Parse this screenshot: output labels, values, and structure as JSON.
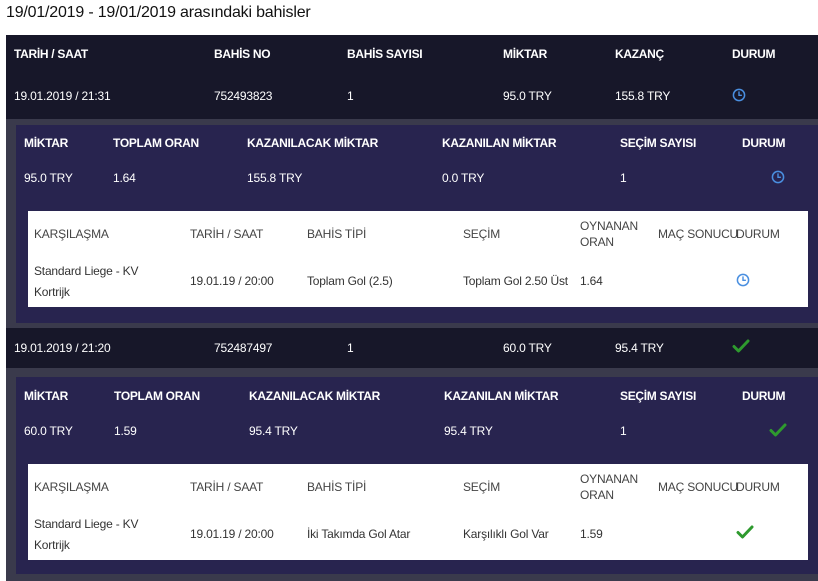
{
  "page_title": "19/01/2019 - 19/01/2019 arasındaki bahisler",
  "main_headers": [
    "TARİH / SAAT",
    "BAHİS NO",
    "BAHİS SAYISI",
    "MİKTAR",
    "KAZANÇ",
    "DURUM"
  ],
  "detail_headers": [
    "MİKTAR",
    "TOPLAM ORAN",
    "KAZANILACAK MİKTAR",
    "KAZANILAN MİKTAR",
    "SEÇİM SAYISI",
    "DURUM"
  ],
  "inner_headers": [
    "KARŞILAŞMA",
    "TARİH / SAAT",
    "BAHİS TİPİ",
    "SEÇİM",
    "OYNANAN ORAN",
    "MAÇ SONUCU",
    "DURUM"
  ],
  "bets": [
    {
      "date": "19.01.2019 / 21:31",
      "bet_no": "752493823",
      "count": "1",
      "amount": "95.0 TRY",
      "win": "155.8 TRY",
      "status": "pending",
      "detail": {
        "amount": "95.0 TRY",
        "total_odds": "1.64",
        "potential": "155.8 TRY",
        "won": "0.0 TRY",
        "selections": "1",
        "status": "pending"
      },
      "match": {
        "teams_line1": "Standard Liege - KV",
        "teams_line2": "Kortrijk",
        "datetime": "19.01.19 / 20:00",
        "bet_type": "Toplam Gol (2.5)",
        "selection": "Toplam Gol 2.50 Üst",
        "odds": "1.64",
        "result": "",
        "status": "pending"
      }
    },
    {
      "date": "19.01.2019 / 21:20",
      "bet_no": "752487497",
      "count": "1",
      "amount": "60.0 TRY",
      "win": "95.4 TRY",
      "status": "won",
      "detail": {
        "amount": "60.0 TRY",
        "total_odds": "1.59",
        "potential": "95.4 TRY",
        "won": "95.4 TRY",
        "selections": "1",
        "status": "won"
      },
      "match": {
        "teams_line1": "Standard Liege - KV",
        "teams_line2": "Kortrijk",
        "datetime": "19.01.19 / 20:00",
        "bet_type": "İki Takımda Gol Atar",
        "selection": "Karşılıklı Gol Var",
        "odds": "1.59",
        "result": "",
        "status": "won"
      }
    }
  ],
  "icons": {
    "pending": "clock-icon",
    "won": "check-icon"
  },
  "colors": {
    "pending_icon": "#4a8fe0",
    "won_icon": "#2e9a2e",
    "header_bg": "#171729",
    "detail_bg": "#28244f"
  }
}
